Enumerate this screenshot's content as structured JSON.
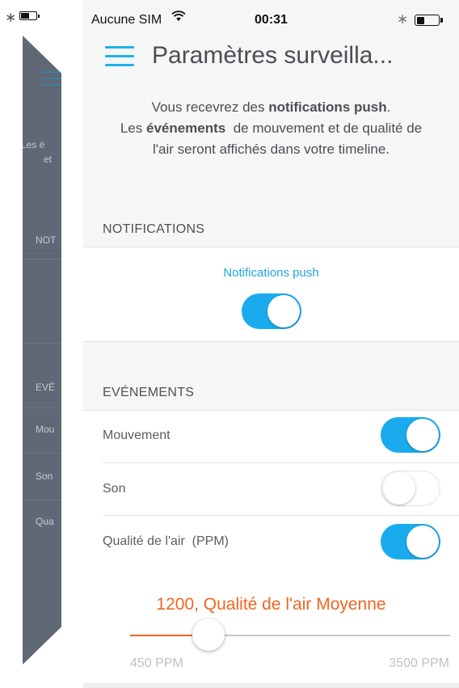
{
  "ghost_screen": {
    "texts": [
      "Les é",
      "et",
      "NOT",
      "EVÉ",
      "Mou",
      "Son",
      "Qua"
    ]
  },
  "status_bar": {
    "carrier": "Aucune SIM",
    "time": "00:31",
    "battery_level": 0.35
  },
  "header": {
    "title": "Paramètres surveilla...",
    "icon": "hamburger-menu-icon"
  },
  "intro": {
    "line1_pre": "Vous recevrez des ",
    "line1_bold": "notifications push",
    "line1_post": ".",
    "line2_pre": "Les ",
    "line2_bold": "événements",
    "line2_post": "  de mouvement et de qualité de",
    "line3": "l'air seront affichés dans votre timeline."
  },
  "notifications": {
    "section_title": "NOTIFICATIONS",
    "push_label": "Notifications push",
    "push_enabled": true
  },
  "events": {
    "section_title": "EVÉNEMENTS",
    "items": [
      {
        "label": "Mouvement",
        "enabled": true
      },
      {
        "label": "Son",
        "enabled": false
      },
      {
        "label": "Qualité de l'air  (PPM)",
        "enabled": true
      }
    ]
  },
  "air_quality_slider": {
    "value_label": "1200, Qualité de l'air Moyenne",
    "value": 1200,
    "min": 450,
    "max": 3500,
    "min_label": "450 PPM",
    "max_label": "3500 PPM"
  },
  "colors": {
    "accent_blue": "#1aabef",
    "accent_orange": "#f2651f",
    "background": "#f5f6f6"
  }
}
